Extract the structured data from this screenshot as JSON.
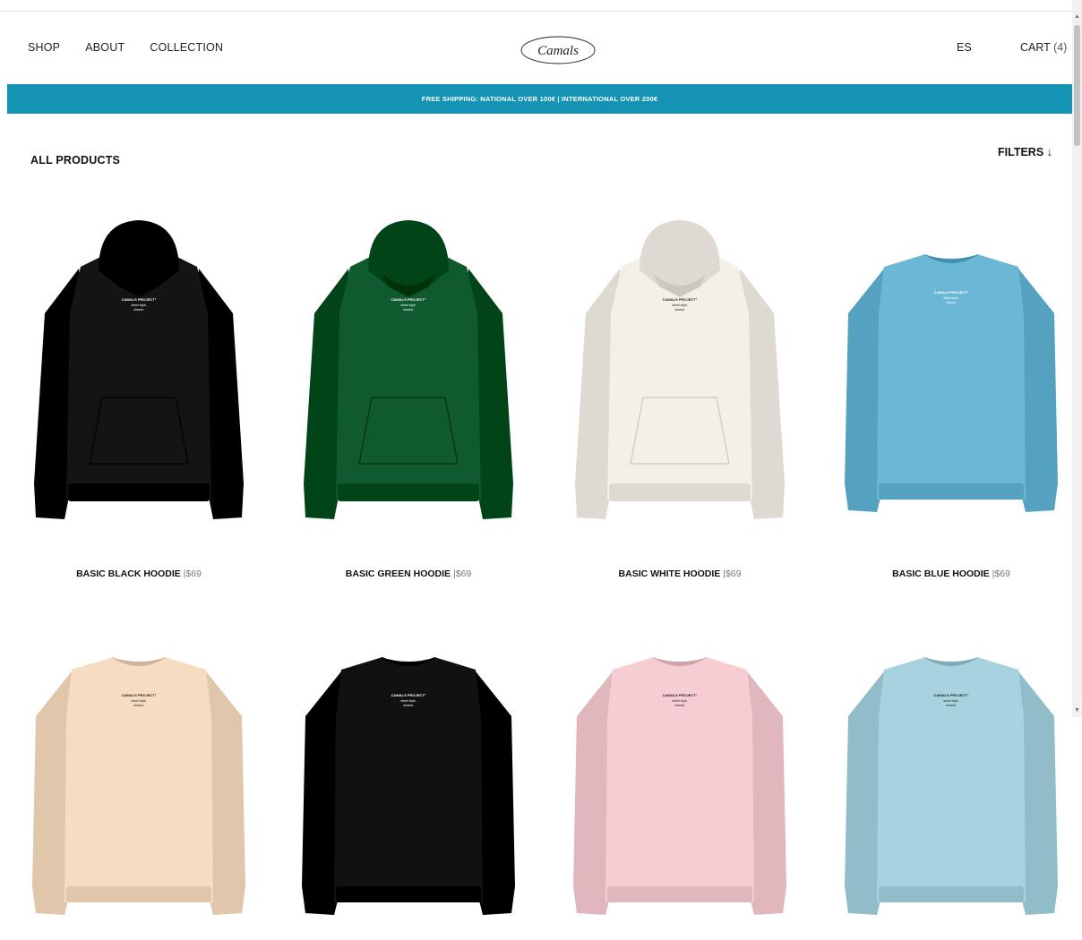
{
  "header": {
    "nav": [
      "SHOP",
      "ABOUT",
      "COLLECTION"
    ],
    "logo_text": "Camals",
    "language": "ES",
    "cart_label": "CART",
    "cart_count": "(4)"
  },
  "banner": {
    "text": "FREE SHIPPING: NATIONAL OVER 100€ | INTERNATIONAL OVER 200€"
  },
  "page": {
    "title": "ALL PRODUCTS",
    "filters_label": "FILTERS ↓"
  },
  "products": [
    {
      "name": "BASIC BLACK HOODIE",
      "price": "|$69",
      "color": "#141414",
      "type": "hoodie",
      "print_color": "#ffffff"
    },
    {
      "name": "BASIC GREEN HOODIE",
      "price": "|$69",
      "color": "#0f5a2e",
      "type": "hoodie",
      "print_color": "#ffffff"
    },
    {
      "name": "BASIC WHITE HOODIE",
      "price": "|$69",
      "color": "#f4efe7",
      "type": "hoodie",
      "print_color": "#222222"
    },
    {
      "name": "BASIC BLUE HOODIE",
      "price": "|$69",
      "color": "#6ab8d6",
      "type": "crewneck",
      "print_color": "#ffffff"
    },
    {
      "name": "",
      "price": "",
      "color": "#f6dcc0",
      "type": "crewneck",
      "print_color": "#222222"
    },
    {
      "name": "",
      "price": "",
      "color": "#111111",
      "type": "crewneck",
      "print_color": "#ffffff"
    },
    {
      "name": "",
      "price": "",
      "color": "#f6cdd2",
      "type": "crewneck",
      "print_color": "#222222"
    },
    {
      "name": "",
      "price": "",
      "color": "#a7d3df",
      "type": "crewneck",
      "print_color": "#222222"
    }
  ],
  "print": {
    "brand": "CAMALS PROJECT°",
    "line1": "street style,",
    "line2": "slowed."
  }
}
